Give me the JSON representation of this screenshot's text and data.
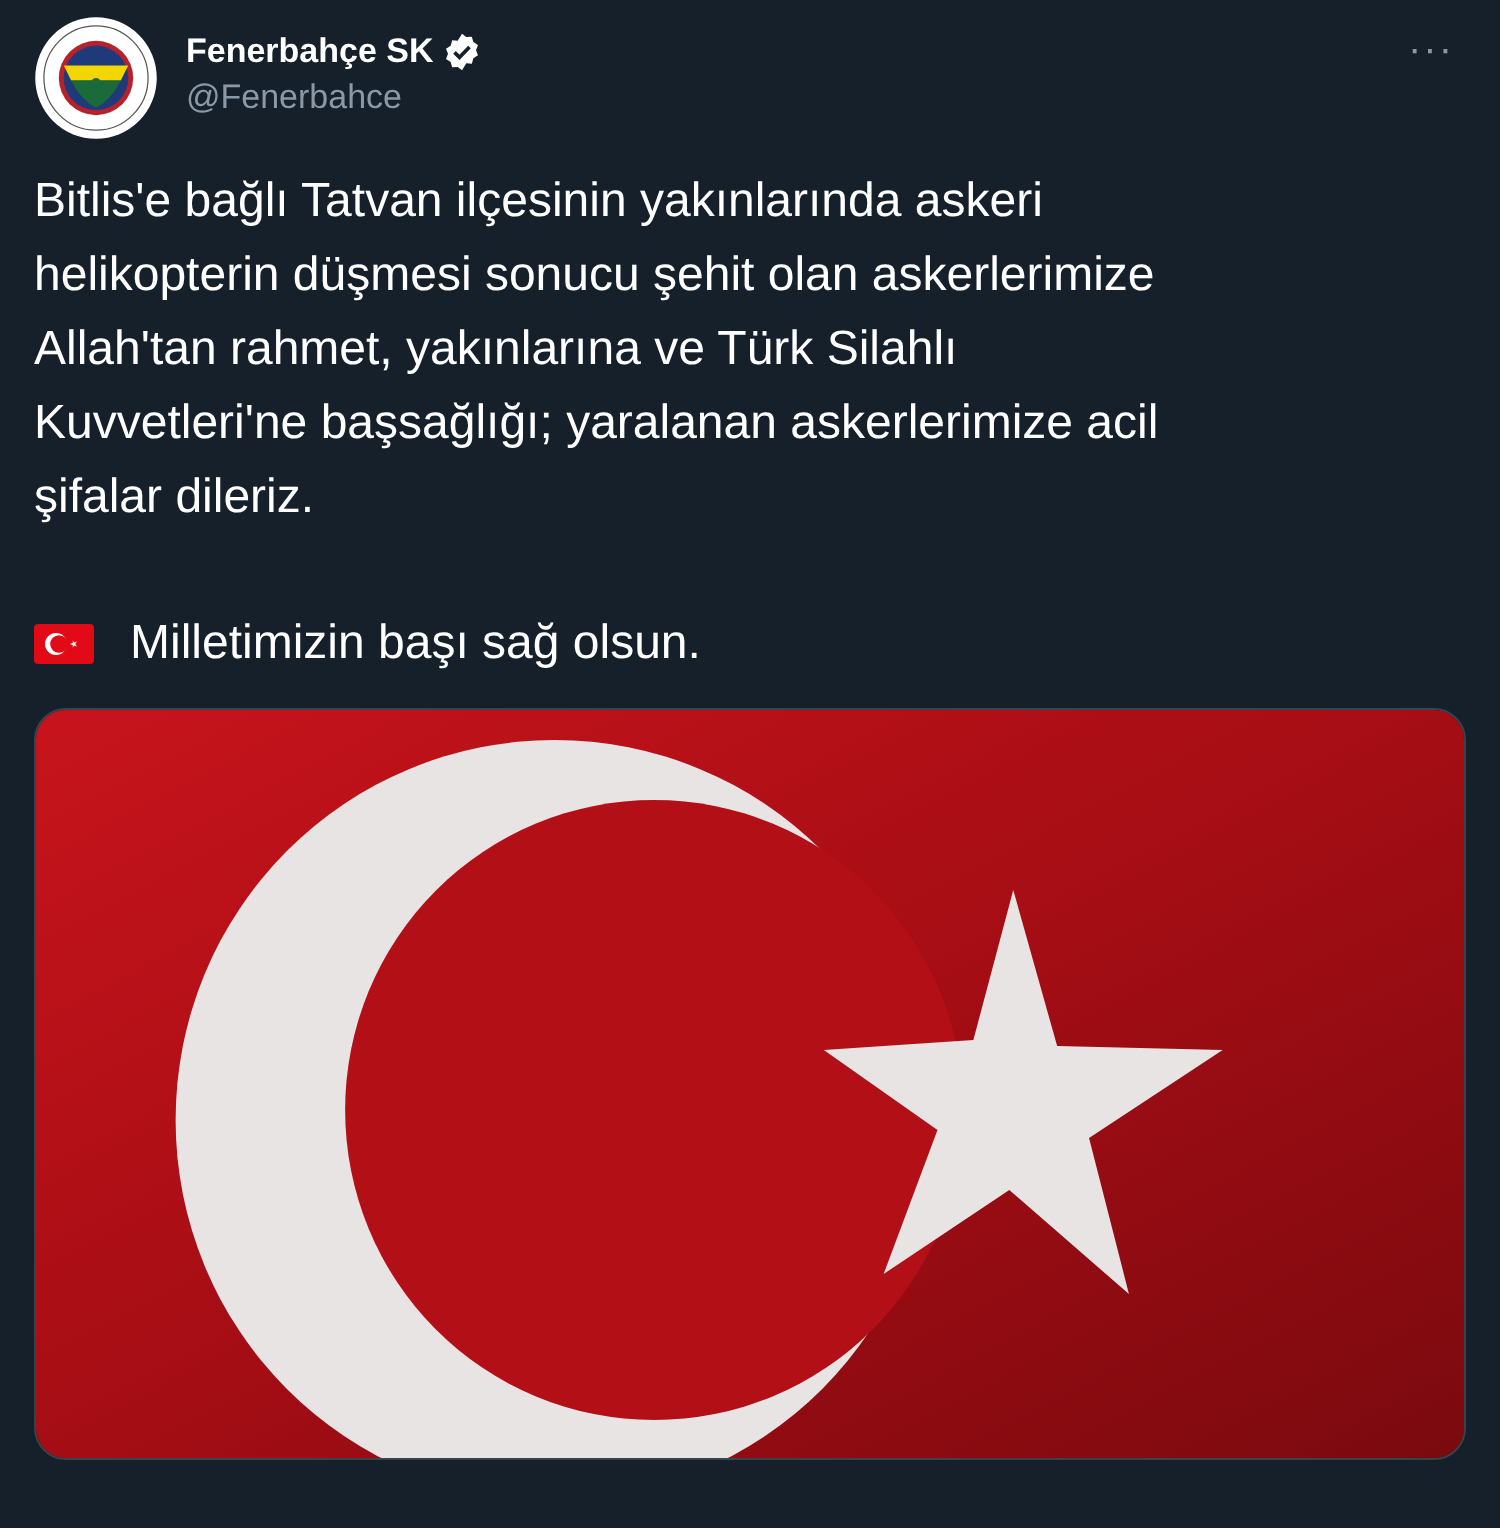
{
  "author": {
    "name": "Fenerbahçe SK",
    "verified": true,
    "handle": "@Fenerbahce"
  },
  "more": "···",
  "paragraphs": [
    {
      "kind": "text",
      "text": "Bitlis'e bağlı Tatvan ilçesinin yakınlarında askeri\nhelikopterin düşmesi sonucu şehit olan askerlerimize\nAllah'tan rahmet, yakınlarına ve Türk Silahlı\nKuvvetleri'ne başsağlığı; yaralanan askerlerimize acil\nşifalar dileriz."
    },
    {
      "kind": "flag",
      "text": "Milletimizin başı sağ olsun."
    }
  ]
}
